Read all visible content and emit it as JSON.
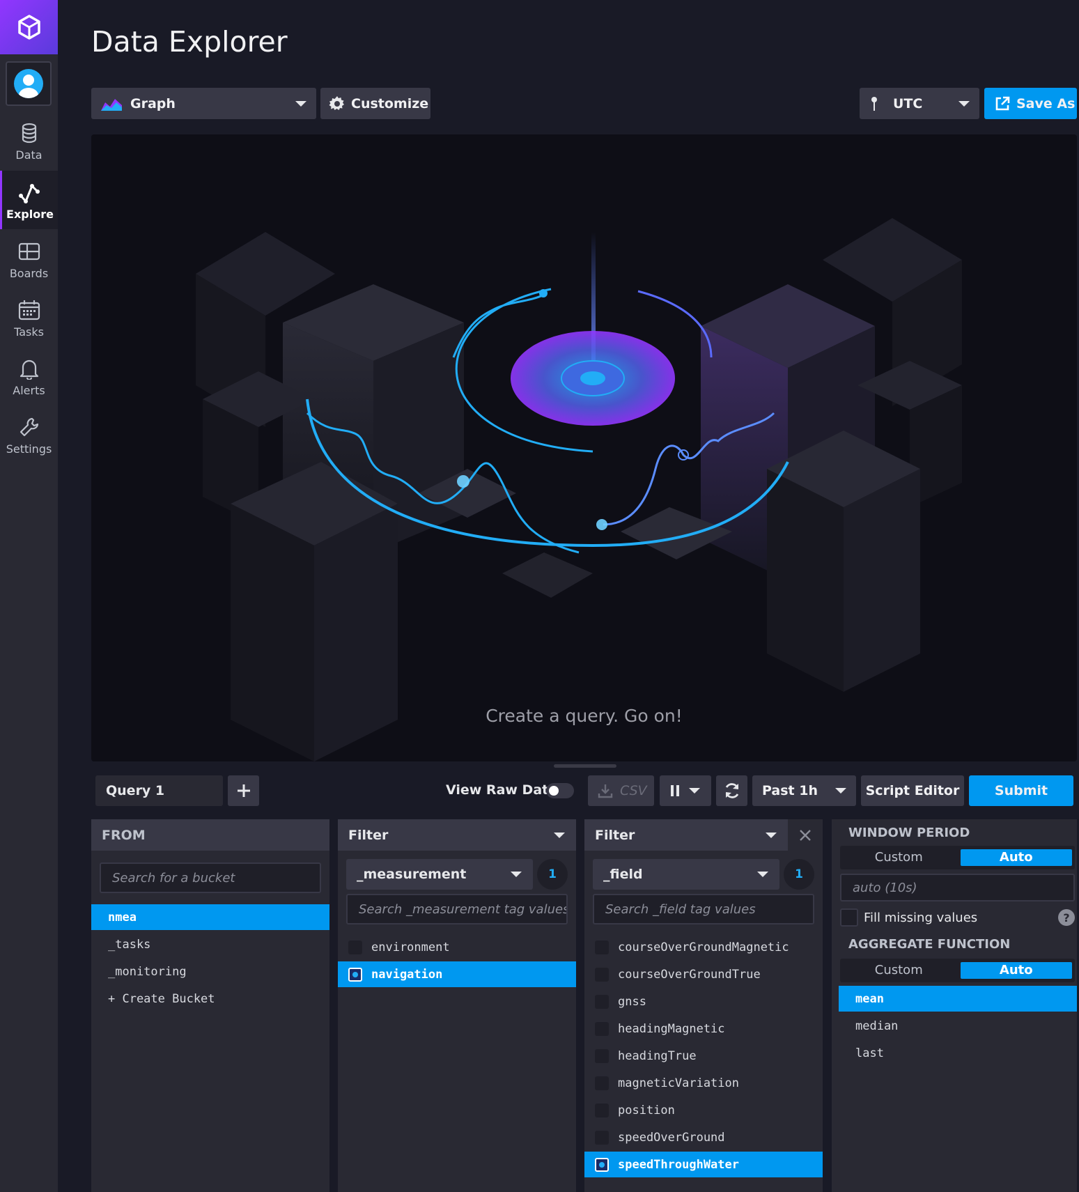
{
  "page": {
    "title": "Data Explorer"
  },
  "sidebar": {
    "items": [
      {
        "label": "Data",
        "icon": "database-icon",
        "active": false
      },
      {
        "label": "Explore",
        "icon": "graph-icon",
        "active": true
      },
      {
        "label": "Boards",
        "icon": "dashboard-icon",
        "active": false
      },
      {
        "label": "Tasks",
        "icon": "calendar-icon",
        "active": false
      },
      {
        "label": "Alerts",
        "icon": "bell-icon",
        "active": false
      },
      {
        "label": "Settings",
        "icon": "wrench-icon",
        "active": false
      }
    ]
  },
  "toolbar": {
    "view_type": "Graph",
    "customize_label": "Customize",
    "timezone": "UTC",
    "save_as_label": "Save As"
  },
  "graph": {
    "empty_message": "Create a query. Go on!"
  },
  "query_bar": {
    "query_tab": "Query 1",
    "view_raw_label": "View Raw Data",
    "csv_label": "CSV",
    "time_range": "Past 1h",
    "script_editor_label": "Script Editor",
    "submit_label": "Submit"
  },
  "from": {
    "header": "FROM",
    "search_placeholder": "Search for a bucket",
    "buckets": [
      "nmea",
      "_tasks",
      "_monitoring",
      "+ Create Bucket"
    ],
    "selected": "nmea"
  },
  "filter1": {
    "header": "Filter",
    "key": "_measurement",
    "count": "1",
    "search_placeholder": "Search _measurement tag values",
    "values": [
      "environment",
      "navigation"
    ],
    "selected": "navigation"
  },
  "filter2": {
    "header": "Filter",
    "key": "_field",
    "count": "1",
    "search_placeholder": "Search _field tag values",
    "values": [
      "courseOverGroundMagnetic",
      "courseOverGroundTrue",
      "gnss",
      "headingMagnetic",
      "headingTrue",
      "magneticVariation",
      "position",
      "speedOverGround",
      "speedThroughWater"
    ],
    "selected": "speedThroughWater"
  },
  "aggregate": {
    "window_header": "WINDOW PERIOD",
    "custom_label": "Custom",
    "auto_label": "Auto",
    "auto_value": "auto (10s)",
    "fill_label": "Fill missing values",
    "help": "?",
    "function_header": "AGGREGATE FUNCTION",
    "functions": [
      "mean",
      "median",
      "last"
    ],
    "selected": "mean"
  },
  "colors": {
    "accent": "#0098f0",
    "brand": "#9236ff",
    "panel": "#292933"
  }
}
